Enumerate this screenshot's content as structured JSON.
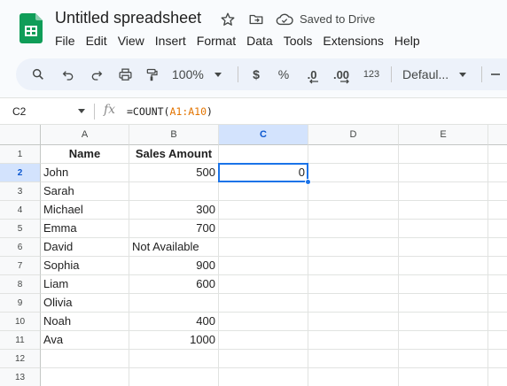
{
  "app": {
    "title": "Untitled spreadsheet",
    "saved_status": "Saved to Drive"
  },
  "menu": [
    "File",
    "Edit",
    "View",
    "Insert",
    "Format",
    "Data",
    "Tools",
    "Extensions",
    "Help"
  ],
  "toolbar": {
    "zoom": "100%",
    "currency": "$",
    "percent": "%",
    "decrease_decimals": ".0",
    "increase_decimals": ".00",
    "number_format": "123",
    "font": "Defaul..."
  },
  "formula_bar": {
    "name_box": "C2",
    "fx": "fx",
    "formula_prefix": "=COUNT(",
    "formula_range": "A1:A10",
    "formula_suffix": ")"
  },
  "grid": {
    "columns": [
      "A",
      "B",
      "C",
      "D",
      "E"
    ],
    "rows": [
      "1",
      "2",
      "3",
      "4",
      "5",
      "6",
      "7",
      "8",
      "9",
      "10",
      "11",
      "12",
      "13"
    ],
    "active_cell": "C2",
    "cells": [
      [
        "Name",
        "Sales Amount",
        "",
        "",
        ""
      ],
      [
        "John",
        "500",
        "0",
        "",
        ""
      ],
      [
        "Sarah",
        "",
        "",
        "",
        ""
      ],
      [
        "Michael",
        "300",
        "",
        "",
        ""
      ],
      [
        "Emma",
        "700",
        "",
        "",
        ""
      ],
      [
        "David",
        "Not Available",
        "",
        "",
        ""
      ],
      [
        "Sophia",
        "900",
        "",
        "",
        ""
      ],
      [
        "Liam",
        "600",
        "",
        "",
        ""
      ],
      [
        "Olivia",
        "",
        "",
        "",
        ""
      ],
      [
        "Noah",
        "400",
        "",
        "",
        ""
      ],
      [
        "Ava",
        "1000",
        "",
        "",
        ""
      ],
      [
        "",
        "",
        "",
        "",
        ""
      ],
      [
        "",
        "",
        "",
        "",
        ""
      ]
    ]
  },
  "colors": {
    "sheets_green": "#0f9d58",
    "selection_blue": "#1a73e8",
    "header_selected": "#d3e3fd",
    "formula_range": "#e37400"
  }
}
